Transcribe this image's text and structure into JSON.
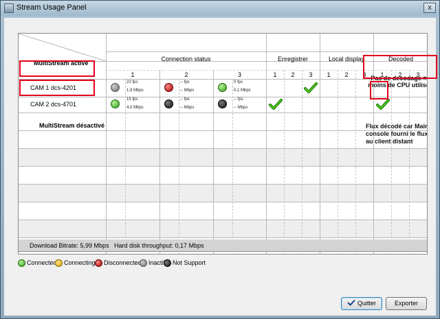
{
  "window": {
    "title": "Stream Usage Panel",
    "close_glyph": "x"
  },
  "header": {
    "multistream_active": "MultiStream activé",
    "connection_status": "Connection status",
    "record": "Enregistrer",
    "local_display": "Local display",
    "decoded": "Decoded",
    "conn_cols": [
      "1",
      "2",
      "3"
    ],
    "rec_cols": [
      "1",
      "2",
      "3"
    ],
    "ld_cols": [
      "1",
      "2",
      "3"
    ],
    "dec_cols": [
      "1",
      "2",
      "3"
    ]
  },
  "cams": [
    {
      "name": "CAM 1 dcs-4201",
      "streams": [
        {
          "status": "inactive",
          "fps": "23 fps",
          "bitrate": "1,9 Mbps"
        },
        {
          "status": "disconnected",
          "fps": "-- fps",
          "bitrate": "-- Mbps"
        },
        {
          "status": "connected",
          "fps": "0 fps",
          "bitrate": "0,1 Mbps"
        }
      ],
      "record_checked": [
        false,
        false,
        true
      ],
      "decoded_checked": [
        false,
        false,
        false
      ]
    },
    {
      "name": "CAM 2 dcs-4701",
      "streams": [
        {
          "status": "connected",
          "fps": "15 fps",
          "bitrate": "4,0 Mbps"
        },
        {
          "status": "not_support",
          "fps": "-- fps",
          "bitrate": "-- Mbps"
        },
        {
          "status": "not_support",
          "fps": "-- fps",
          "bitrate": "-- Mbps"
        }
      ],
      "record_checked": [
        true,
        false,
        false
      ],
      "decoded_checked": [
        true,
        false,
        false
      ]
    }
  ],
  "multistream_inactive": "MultiStream désactivé",
  "annotations": {
    "no_decoding": "Pas de decodage = moins de CPU utilisé",
    "decoded_note": "Flux décodé car Main console fourni le flux au client distant"
  },
  "footer": {
    "download_bitrate": "Download Bitrate: 5,99 Mbps",
    "hdd_throughput": "Hard disk throughput: 0,17 Mbps"
  },
  "legend": [
    {
      "label": "Connected",
      "color": "#3bb31a"
    },
    {
      "label": "Connecting",
      "color": "#f2c200"
    },
    {
      "label": "Disconnected",
      "color": "#b10000"
    },
    {
      "label": "Inactif",
      "color": "#8a8a8a"
    },
    {
      "label": "Not Support",
      "color": "#111111"
    }
  ],
  "buttons": {
    "quit": "Quitter",
    "export": "Exporter"
  },
  "colors": {
    "highlight_box": "#e2001a",
    "check": "#2fa30c"
  }
}
